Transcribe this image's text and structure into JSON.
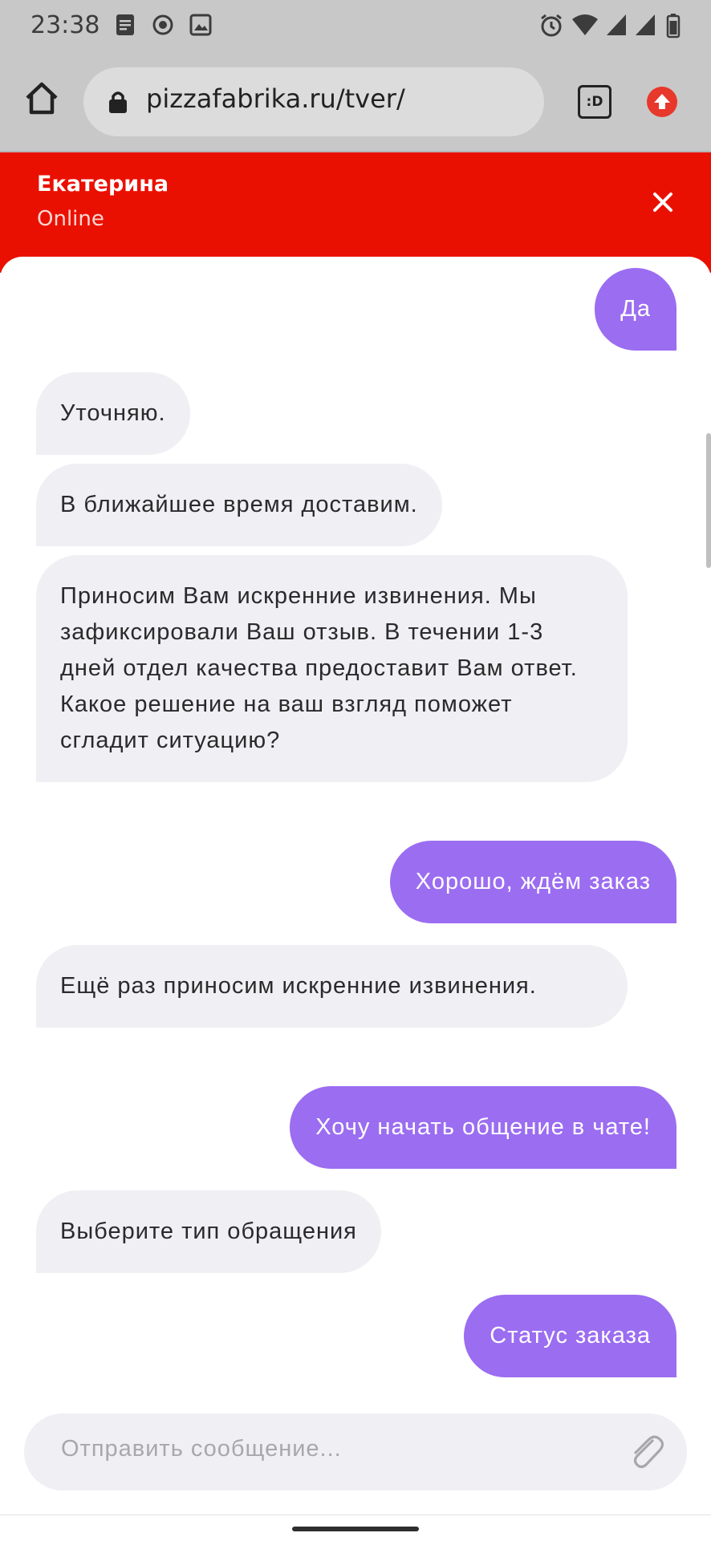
{
  "status_bar": {
    "time": "23:38",
    "left_icons": [
      "document-icon",
      "record-icon",
      "image-icon"
    ],
    "right_icons": [
      "alarm-icon",
      "wifi-icon",
      "signal-icon",
      "signal-icon",
      "battery-icon"
    ]
  },
  "browser": {
    "url": "pizzafabrika.ru/tver/",
    "tab_button_label": ":D",
    "icons": [
      "home-icon",
      "lock-icon",
      "extension-icon"
    ]
  },
  "chat_header": {
    "agent_name": "Екатерина",
    "agent_status": "Online",
    "close_icon": "close-icon"
  },
  "messages": [
    {
      "from": "user",
      "text": "Да"
    },
    {
      "from": "agent",
      "text": "Уточняю."
    },
    {
      "from": "agent",
      "text": "В ближайшее время доставим."
    },
    {
      "from": "agent",
      "text": "Приносим Вам искренние извинения. Мы зафиксировали Ваш отзыв. В течении 1-3 дней отдел качества предоставит Вам ответ. Какое решение на ваш взгляд поможет сгладит ситуацию?"
    },
    {
      "from": "user",
      "text": "Хорошо, ждём заказ"
    },
    {
      "from": "agent",
      "text": "Ещё раз приносим искренние извинения."
    },
    {
      "from": "user",
      "text": "Хочу начать общение в чате!"
    },
    {
      "from": "agent",
      "text": "Выберите тип обращения"
    },
    {
      "from": "user",
      "text": "Статус заказа"
    }
  ],
  "composer": {
    "placeholder": "Отправить сообщение...",
    "attach_icon": "paperclip-icon"
  },
  "colors": {
    "header": "#ea1001",
    "user_bubble": "#9b6df1",
    "agent_bubble": "#efeff4"
  }
}
